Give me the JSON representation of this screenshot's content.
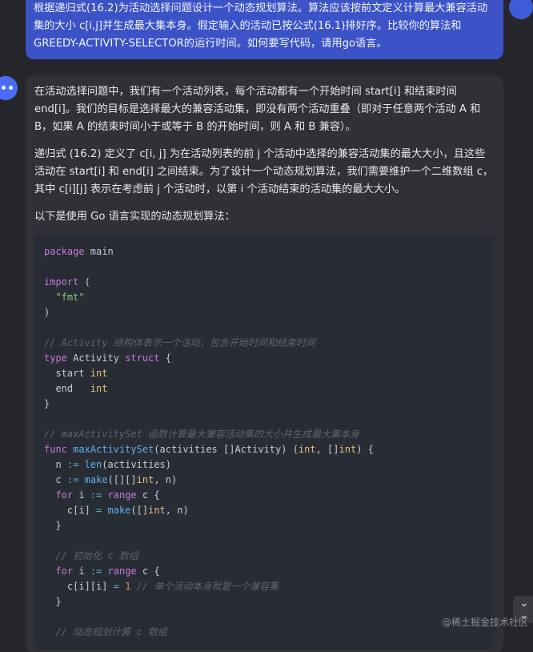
{
  "user_message": "根据递归式(16.2)为活动选择问题设计一个动态规划算法。算法应该按前文定义计算最大兼容活动集的大小 c[i,j]并生成最大集本身。假定输入的活动已按公式(16.1)排好序。比较你的算法和GREEDY-ACTIVITY-SELECTOR的运行时间。如何要写代码，请用go语言。",
  "answer": {
    "p1": "在活动选择问题中，我们有一个活动列表，每个活动都有一个开始时间 start[i] 和结束时间 end[i]。我们的目标是选择最大的兼容活动集，即没有两个活动重叠（即对于任意两个活动 A 和 B，如果 A 的结束时间小于或等于 B 的开始时间，则 A 和 B 兼容）。",
    "p2": "递归式 (16.2) 定义了 c[i, j] 为在活动列表的前 j 个活动中选择的兼容活动集的最大大小，且这些活动在 start[i] 和 end[i] 之间结束。为了设计一个动态规划算法，我们需要维护一个二维数组 c，其中 c[i][j] 表示在考虑前 j 个活动时，以第 i 个活动结束的活动集的最大大小。",
    "p3": "以下是使用 Go 语言实现的动态规划算法："
  },
  "code": {
    "l1": "package main",
    "l3": "import (",
    "l4": "\"fmt\"",
    "l5": ")",
    "c1": "// Activity 结构体表示一个活动，包含开始时间和结束时间",
    "l8": "type Activity struct {",
    "l9a": "start",
    "l9b": "int",
    "l10a": "end",
    "l10b": "int",
    "l11": "}",
    "c2": "// maxActivitySet 函数计算最大兼容活动集的大小并生成最大集本身",
    "c3": "// 初始化 c 数组",
    "c4": "// 单个活动本身就是一个兼容集",
    "c5": "// 动态规划计算 c 数组"
  },
  "icons": {
    "scroll_down": "double-chevron-down-icon"
  },
  "watermark": "@稀土掘金技术社区",
  "colors": {
    "user_bubble": "#3b53c7",
    "background": "#25262b",
    "answer_card": "#303136",
    "code_bg": "#282c34"
  }
}
